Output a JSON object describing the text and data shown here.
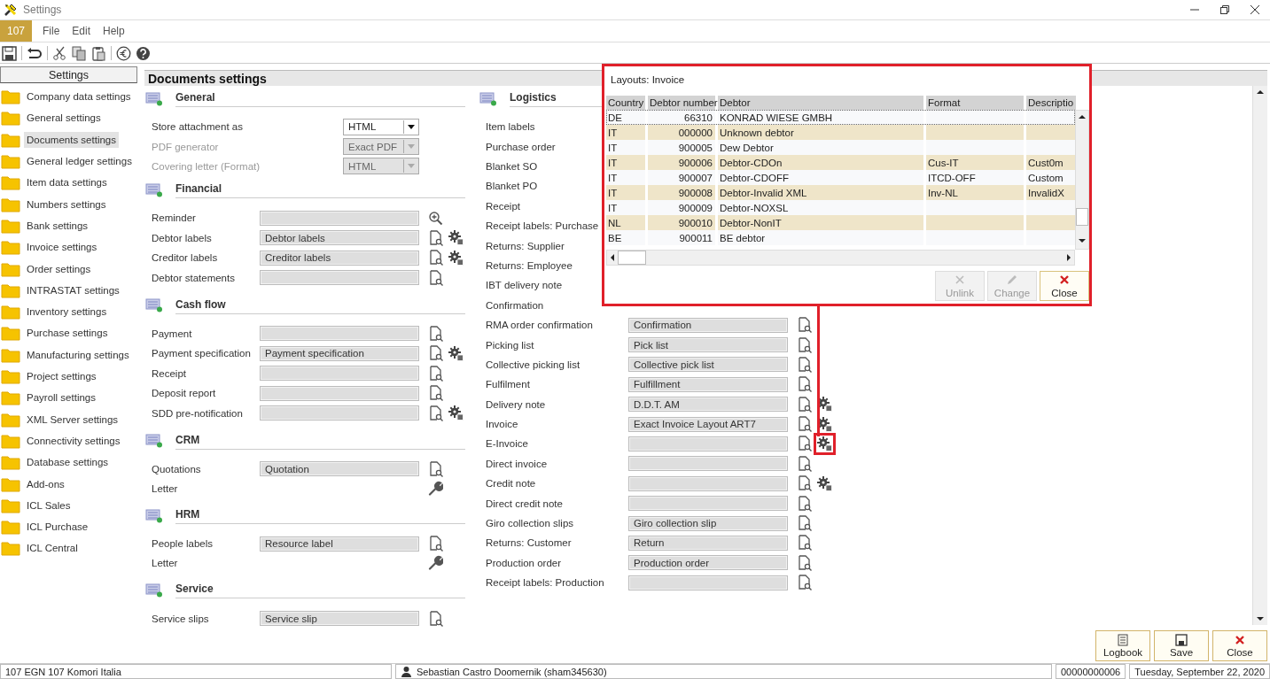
{
  "window": {
    "title": "Settings"
  },
  "menu": {
    "company": "107",
    "items": [
      "File",
      "Edit",
      "Help"
    ]
  },
  "sidebar": {
    "title": "Settings",
    "items": [
      {
        "label": "Company data settings",
        "selected": false
      },
      {
        "label": "General settings",
        "selected": false
      },
      {
        "label": "Documents settings",
        "selected": true
      },
      {
        "label": "General ledger settings",
        "selected": false
      },
      {
        "label": "Item data settings",
        "selected": false
      },
      {
        "label": "Numbers settings",
        "selected": false
      },
      {
        "label": "Bank settings",
        "selected": false
      },
      {
        "label": "Invoice settings",
        "selected": false
      },
      {
        "label": "Order settings",
        "selected": false
      },
      {
        "label": "INTRASTAT settings",
        "selected": false
      },
      {
        "label": "Inventory settings",
        "selected": false
      },
      {
        "label": "Purchase settings",
        "selected": false
      },
      {
        "label": "Manufacturing settings",
        "selected": false
      },
      {
        "label": "Project settings",
        "selected": false
      },
      {
        "label": "Payroll settings",
        "selected": false
      },
      {
        "label": "XML Server settings",
        "selected": false
      },
      {
        "label": "Connectivity settings",
        "selected": false
      },
      {
        "label": "Database settings",
        "selected": false
      },
      {
        "label": "Add-ons",
        "selected": false
      },
      {
        "label": "ICL Sales",
        "selected": false
      },
      {
        "label": "ICL Purchase",
        "selected": false
      },
      {
        "label": "ICL Central",
        "selected": false
      }
    ]
  },
  "panel": {
    "title": "Documents settings",
    "columns": [
      {
        "sections": [
          {
            "title": "General",
            "rows": [
              {
                "label": "Store attachment as",
                "kind": "dropdown",
                "value": "HTML",
                "disabled": false
              },
              {
                "label": "PDF generator",
                "kind": "dropdown",
                "value": "Exact PDF",
                "disabled": true
              },
              {
                "label": "Covering letter (Format)",
                "kind": "dropdown",
                "value": "HTML",
                "disabled": true
              }
            ]
          },
          {
            "title": "Financial",
            "rows": [
              {
                "label": "Reminder",
                "kind": "search",
                "configurable": false
              },
              {
                "label": "Debtor labels",
                "kind": "lookup",
                "value": "Debtor labels",
                "configurable": true
              },
              {
                "label": "Creditor labels",
                "kind": "lookup",
                "value": "Creditor labels",
                "configurable": true
              },
              {
                "label": "Debtor statements",
                "kind": "lookup",
                "configurable": false
              }
            ]
          },
          {
            "title": "Cash flow",
            "rows": [
              {
                "label": "Payment",
                "kind": "lookup",
                "configurable": false
              },
              {
                "label": "Payment specification",
                "kind": "lookup",
                "value": "Payment specification",
                "configurable": true
              },
              {
                "label": "Receipt",
                "kind": "lookup",
                "configurable": false
              },
              {
                "label": "Deposit report",
                "kind": "lookup",
                "configurable": false
              },
              {
                "label": "SDD pre-notification",
                "kind": "lookup",
                "configurable": true
              }
            ]
          },
          {
            "title": "CRM",
            "rows": [
              {
                "label": "Quotations",
                "kind": "lookup",
                "value": "Quotation",
                "configurable": false
              },
              {
                "label": "Letter",
                "kind": "template"
              }
            ]
          },
          {
            "title": "HRM",
            "rows": [
              {
                "label": "People labels",
                "kind": "lookup",
                "value": "Resource label",
                "configurable": false
              },
              {
                "label": "Letter",
                "kind": "template"
              }
            ]
          },
          {
            "title": "Service",
            "rows": [
              {
                "label": "Service slips",
                "kind": "lookup",
                "value": "Service slip",
                "configurable": false
              }
            ]
          }
        ]
      },
      {
        "sections": [
          {
            "title": "Logistics",
            "rows": [
              {
                "label": "Item labels",
                "kind": "covered"
              },
              {
                "label": "Purchase order",
                "kind": "covered"
              },
              {
                "label": "Blanket SO",
                "kind": "covered"
              },
              {
                "label": "Blanket PO",
                "kind": "covered"
              },
              {
                "label": "Receipt",
                "kind": "covered"
              },
              {
                "label": "Receipt labels: Purchase",
                "kind": "covered"
              },
              {
                "label": "Returns: Supplier",
                "kind": "covered"
              },
              {
                "label": "Returns: Employee",
                "kind": "covered"
              },
              {
                "label": "IBT delivery note",
                "kind": "covered"
              },
              {
                "label": "Confirmation",
                "kind": "covered"
              },
              {
                "label": "RMA order confirmation",
                "kind": "lookup",
                "value": "Confirmation",
                "configurable": false
              },
              {
                "label": "Picking list",
                "kind": "lookup",
                "value": "Pick list",
                "configurable": false
              },
              {
                "label": "Collective picking list",
                "kind": "lookup",
                "value": "Collective pick list",
                "configurable": false
              },
              {
                "label": "Fulfilment",
                "kind": "lookup",
                "value": "Fulfillment",
                "configurable": false
              },
              {
                "label": "Delivery note",
                "kind": "lookup",
                "value": "D.D.T. AM",
                "configurable": true
              },
              {
                "label": "Invoice",
                "kind": "lookup",
                "value": "Exact Invoice Layout ART7",
                "configurable": true
              },
              {
                "label": "E-Invoice",
                "kind": "lookup",
                "configurable": true,
                "highlighted": true
              },
              {
                "label": "Direct invoice",
                "kind": "lookup",
                "configurable": false
              },
              {
                "label": "Credit note",
                "kind": "lookup",
                "configurable": true
              },
              {
                "label": "Direct credit note",
                "kind": "lookup",
                "configurable": false
              },
              {
                "label": "Giro collection slips",
                "kind": "lookup",
                "value": "Giro collection slip",
                "configurable": false
              },
              {
                "label": "Returns: Customer",
                "kind": "lookup",
                "value": "Return",
                "configurable": false
              },
              {
                "label": "Production order",
                "kind": "lookup",
                "value": "Production order",
                "configurable": false
              },
              {
                "label": "Receipt labels: Production",
                "kind": "lookup",
                "configurable": false
              }
            ]
          }
        ]
      }
    ],
    "buttons": [
      "Logbook",
      "Save",
      "Close"
    ]
  },
  "dialog": {
    "title": "Layouts: Invoice",
    "columns": [
      "Country",
      "Debtor number",
      "Debtor",
      "Format",
      "Descriptio"
    ],
    "rows": [
      {
        "cells": [
          "DE",
          "66310",
          "KONRAD WIESE GMBH",
          "",
          ""
        ],
        "focused": true
      },
      {
        "cells": [
          "IT",
          "000000",
          "Unknown debtor",
          "",
          ""
        ],
        "focused": false
      },
      {
        "cells": [
          "IT",
          "900005",
          "Dew Debtor",
          "",
          ""
        ],
        "focused": false
      },
      {
        "cells": [
          "IT",
          "900006",
          "Debtor-CDOn",
          "Cus-IT",
          "Cust0m"
        ],
        "focused": false
      },
      {
        "cells": [
          "IT",
          "900007",
          "Debtor-CDOFF",
          "ITCD-OFF",
          "Custom"
        ],
        "focused": false
      },
      {
        "cells": [
          "IT",
          "900008",
          "Debtor-Invalid XML",
          "Inv-NL",
          "InvalidX"
        ],
        "focused": false
      },
      {
        "cells": [
          "IT",
          "900009",
          "Debtor-NOXSL",
          "",
          ""
        ],
        "focused": false
      },
      {
        "cells": [
          "NL",
          "900010",
          "Debtor-NonIT",
          "",
          ""
        ],
        "focused": false
      },
      {
        "cells": [
          "BE",
          "900011",
          "BE debtor",
          "",
          ""
        ],
        "focused": false
      }
    ],
    "buttons": [
      {
        "label": "Unlink",
        "disabled": true
      },
      {
        "label": "Change",
        "disabled": true
      },
      {
        "label": "Close",
        "disabled": false
      }
    ]
  },
  "status_bar": {
    "company": "107 EGN 107 Komori Italia",
    "user": "Sebastian Castro Doomernik (sham345630)",
    "number": "00000000006",
    "date": "Tuesday, September 22, 2020"
  }
}
